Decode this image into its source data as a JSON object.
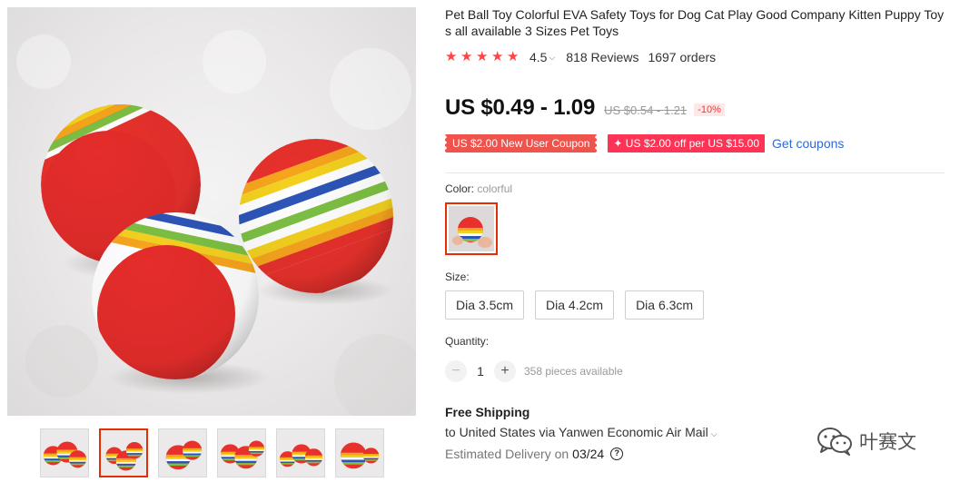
{
  "product": {
    "title": "Pet Ball Toy Colorful EVA Safety Toys for Dog Cat Play Good Company Kitten Puppy Toys all available 3 Sizes Pet Toys",
    "rating": {
      "stars": 5,
      "value_text": "4.5",
      "caret_icon": "chevron-down-icon",
      "reviews": "818 Reviews",
      "orders": "1697 orders"
    },
    "price": {
      "current": "US $0.49 - 1.09",
      "original": "US $0.54 - 1.21",
      "discount": "-10%"
    },
    "coupons": {
      "new_user": "US $2.00 New User Coupon",
      "store": "✦ US $2.00 off per US $15.00",
      "get_link": "Get coupons"
    },
    "color": {
      "label": "Color:",
      "value": "colorful"
    },
    "size": {
      "label": "Size:",
      "options": [
        "Dia 3.5cm",
        "Dia 4.2cm",
        "Dia 6.3cm"
      ]
    },
    "quantity": {
      "label": "Quantity:",
      "minus": "−",
      "plus": "+",
      "value": "1",
      "available": "358 pieces available"
    },
    "shipping": {
      "title": "Free Shipping",
      "destination": "to United States via Yanwen Economic Air Mail",
      "delivery_label": "Estimated Delivery on",
      "delivery_date": "03/24",
      "help_icon": "question-circle-icon"
    }
  },
  "gallery": {
    "thumbnail_count": 6,
    "active_index": 1
  },
  "watermark": {
    "text": "叶赛文",
    "icon": "wechat-icon"
  },
  "colors": {
    "accent_red": "#e62e04",
    "star_red": "#f44444",
    "coupon_red": "#f0524c",
    "link_blue": "#2e6ad7"
  }
}
